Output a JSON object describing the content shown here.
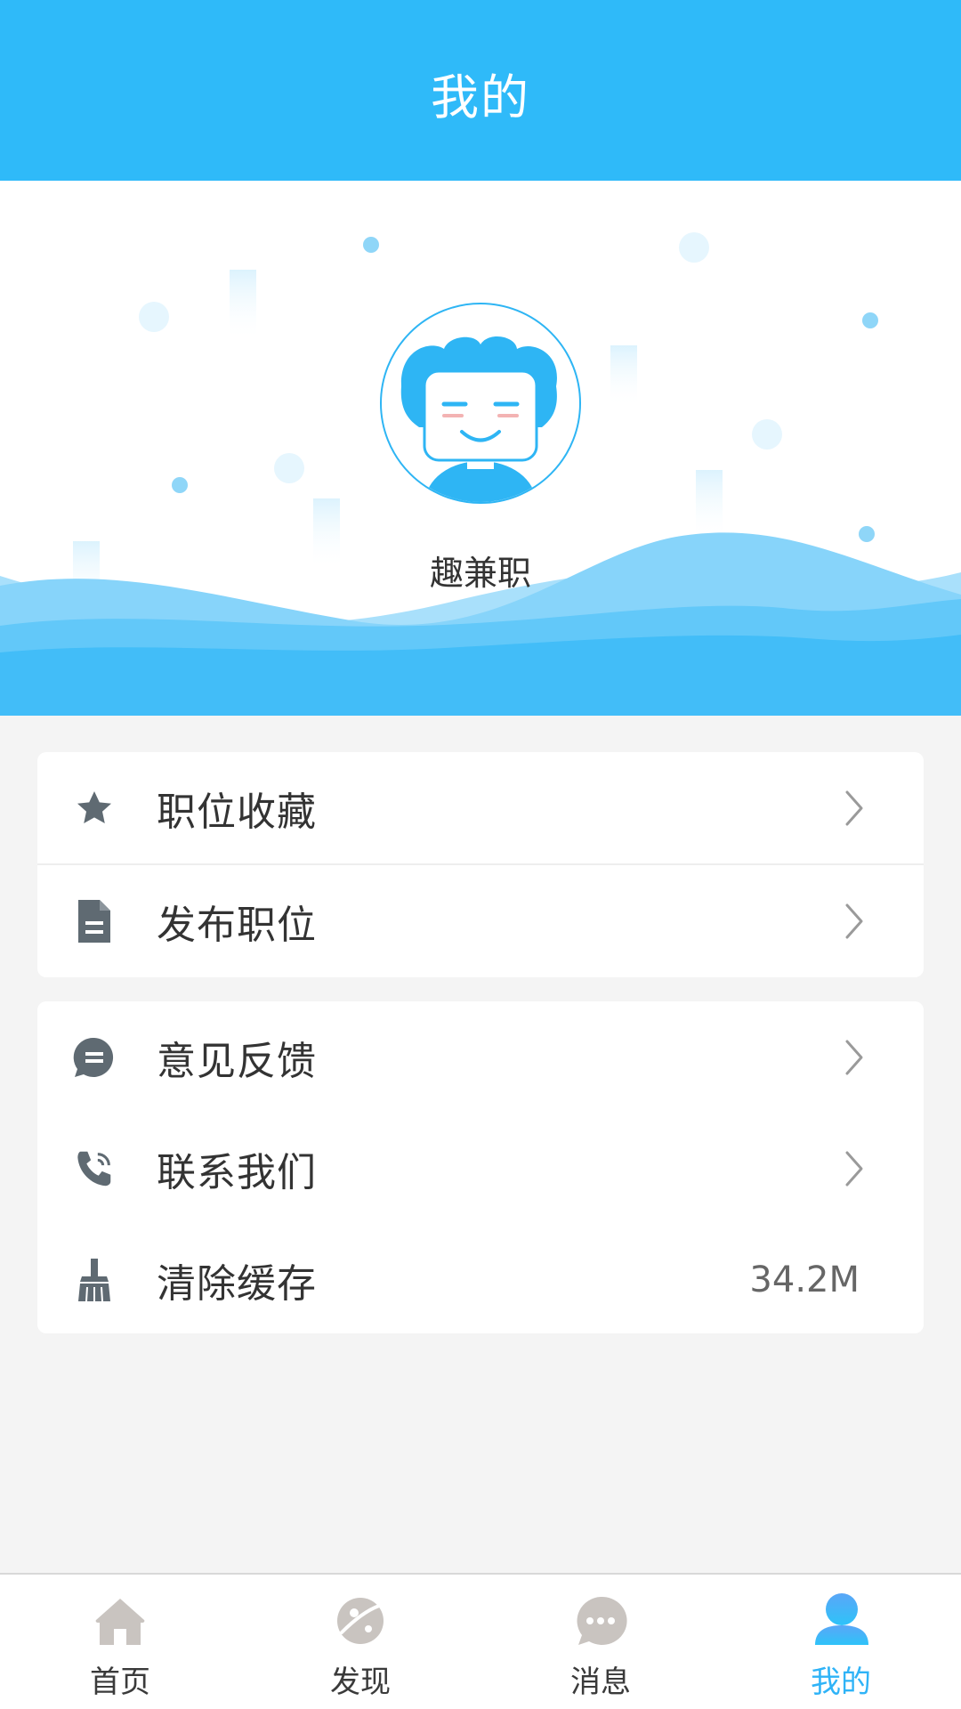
{
  "header": {
    "title": "我的"
  },
  "profile": {
    "username": "趣兼职"
  },
  "menu_group_1": [
    {
      "label": "职位收藏",
      "icon": "star-icon"
    },
    {
      "label": "发布职位",
      "icon": "document-icon"
    }
  ],
  "menu_group_2": [
    {
      "label": "意见反馈",
      "icon": "chat-bubble-icon"
    },
    {
      "label": "联系我们",
      "icon": "phone-icon"
    },
    {
      "label": "清除缓存",
      "icon": "broom-icon",
      "value": "34.2M"
    }
  ],
  "tabbar": {
    "tabs": [
      {
        "label": "首页",
        "icon": "home-icon"
      },
      {
        "label": "发现",
        "icon": "planet-icon"
      },
      {
        "label": "消息",
        "icon": "message-icon"
      },
      {
        "label": "我的",
        "icon": "user-icon",
        "active": true
      }
    ]
  },
  "colors": {
    "primary": "#2fbaf9",
    "active_tab": "#2fb3f7",
    "inactive_tab_icon": "#c9c4c0",
    "menu_icon": "#5f6a72"
  }
}
